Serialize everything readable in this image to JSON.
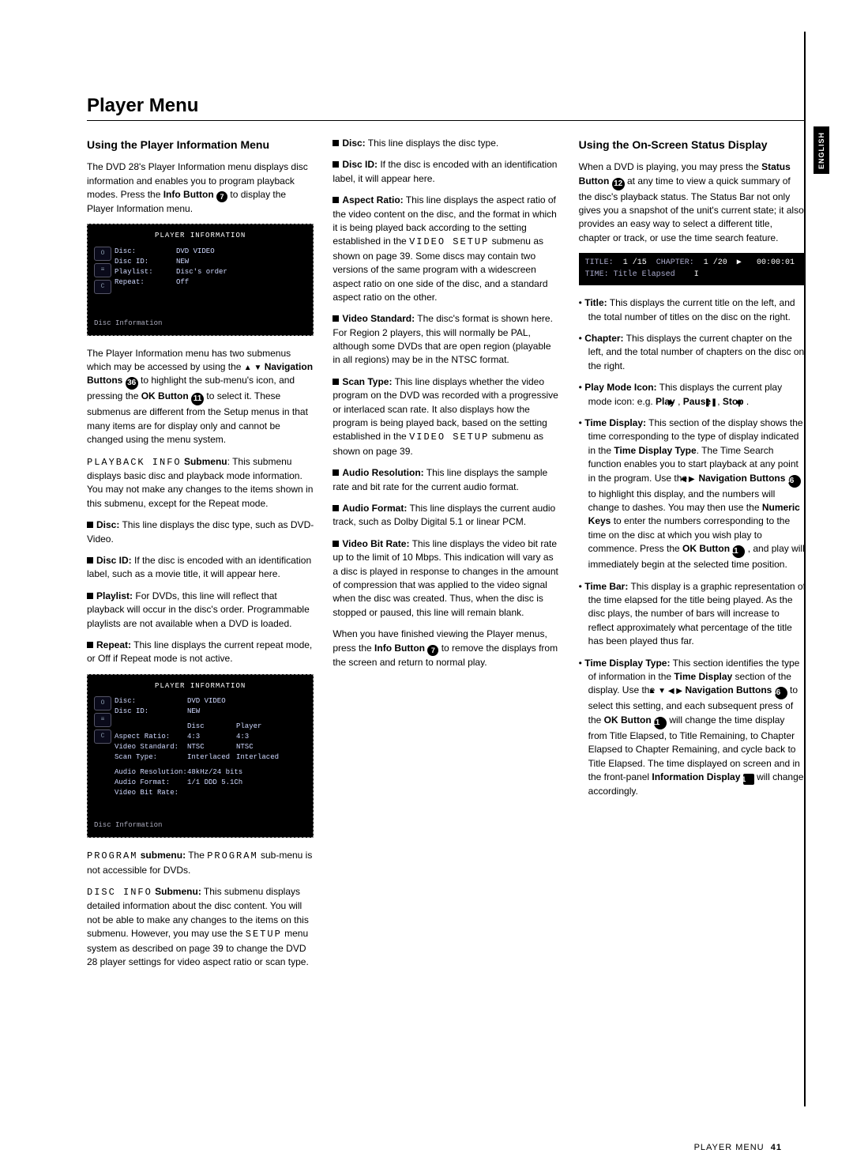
{
  "tab": "ENGLISH",
  "title": "Player Menu",
  "footer": {
    "section": "PLAYER MENU",
    "page": "41"
  },
  "col1": {
    "h": "Using the Player Information Menu",
    "p1a": "The DVD 28's Player Information menu displays disc information and enables you to program playback modes. Press the ",
    "p1b": "Info Button",
    "p1c": " to display the Player Information menu.",
    "osd1": {
      "title": "PLAYER INFORMATION",
      "rows": [
        {
          "k": "Disc:",
          "v": "DVD VIDEO"
        },
        {
          "k": "Disc ID:",
          "v": "NEW"
        },
        {
          "k": "Playlist:",
          "v": "Disc's order"
        },
        {
          "k": "Repeat:",
          "v": "Off"
        }
      ],
      "footer": "Disc Information"
    },
    "p2a": "The Player Information menu has two submenus which may be accessed by using the ",
    "p2b": "Navigation Buttons",
    "p2c": " to highlight the sub-menu's icon, and pressing the ",
    "p2d": "OK Button",
    "p2e": " to select it. These submenus are different from the Setup menus in that many items are for display only and cannot be changed using the menu system.",
    "pbi_label": "PLAYBACK INFO",
    "pbi_sub": " Submenu",
    "pbi_txt": ": This submenu displays basic disc and playback mode information. You may not make any changes to the items shown in this submenu, except for the Repeat mode.",
    "li1k": "Disc:",
    "li1v": " This line displays the disc type, such as DVD-Video.",
    "li2k": "Disc ID:",
    "li2v": " If the disc is encoded with an identification label, such as a movie title, it will appear here.",
    "li3k": "Playlist:",
    "li3v": " For DVDs, this line will reflect that playback will occur in the disc's order. Programmable playlists are not available when a DVD is loaded.",
    "li4k": "Repeat:",
    "li4v": " This line displays the current repeat mode, or Off if Repeat mode is not active.",
    "osd2": {
      "title": "PLAYER INFORMATION",
      "top": [
        {
          "k": "Disc:",
          "v": "DVD VIDEO"
        },
        {
          "k": "Disc ID:",
          "v": "NEW"
        }
      ],
      "hd": {
        "c1": "Disc",
        "c2": "Player"
      },
      "mid": [
        {
          "k": "Aspect Ratio:",
          "c1": "4:3",
          "c2": "4:3"
        },
        {
          "k": "Video Standard:",
          "c1": "NTSC",
          "c2": "NTSC"
        },
        {
          "k": "Scan Type:",
          "c1": "Interlaced",
          "c2": "Interlaced"
        }
      ],
      "bot": [
        {
          "k": "Audio Resolution:",
          "v": "48kHz/24 bits"
        },
        {
          "k": "Audio Format:",
          "v": "1/1 DDD 5.1Ch"
        },
        {
          "k": "Video Bit Rate:",
          "v": ""
        }
      ],
      "footer": "Disc Information"
    },
    "prog_label": "PROGRAM",
    "prog_sub": " submenu:",
    "prog_txt": " The ",
    "prog_label2": "PROGRAM",
    "prog_txt2": " sub-menu is not accessible for DVDs.",
    "di_label": "DISC INFO",
    "di_sub": " Submenu:",
    "di_txt": " This submenu displays detailed information about the disc content. You will not be able to make any changes to the items on this submenu. However, you may use the ",
    "di_setup": "SETUP",
    "di_txt2": " menu system as described on page 39 to change the DVD 28 player settings for video aspect ratio or scan type."
  },
  "col2": {
    "l1k": "Disc:",
    "l1v": " This line displays the disc type.",
    "l2k": "Disc ID:",
    "l2v": " If the disc is encoded with an identification label, it will appear here.",
    "l3k": "Aspect Ratio:",
    "l3v1": " This line displays the aspect ratio of the video content on the disc, and the format in which it is being played back according to the setting established in the ",
    "l3setup": "VIDEO SETUP",
    "l3v2": " submenu as shown on page 39. Some discs may contain two versions of the same program with a widescreen aspect ratio on one side of the disc, and a standard aspect ratio on the other.",
    "l4k": "Video Standard:",
    "l4v": " The disc's format is shown here. For Region 2 players, this will normally be PAL, although some DVDs that are open region (playable in all regions) may be in the NTSC format.",
    "l5k": "Scan Type:",
    "l5v1": " This line displays whether the video program on the DVD was recorded with a progressive or interlaced scan rate. It also displays how the program is being played back, based on the setting established in the ",
    "l5setup": "VIDEO SETUP",
    "l5v2": " submenu as shown on page 39.",
    "l6k": "Audio Resolution:",
    "l6v": " This line displays the sample rate and bit rate for the current audio format.",
    "l7k": "Audio Format:",
    "l7v": " This line displays the current audio track, such as Dolby Digital 5.1 or linear PCM.",
    "l8k": "Video Bit Rate:",
    "l8v": " This line displays the video bit rate up to the limit of 10 Mbps. This indication will vary as a disc is played in response to changes in the amount of compression that was applied to the video signal when the disc was created. Thus, when the disc is stopped or paused, this line will remain blank.",
    "endA": "When you have finished viewing the Player menus, press the ",
    "endB": "Info Button",
    "endC": " to remove the displays from the screen and return to normal play."
  },
  "col3": {
    "h": "Using the On-Screen Status Display",
    "p1a": "When a DVD is playing, you may press the ",
    "p1b": "Status Button",
    "p1c": " at any time to view a quick summary of the disc's playback status. The Status Bar not only gives you a snapshot of the unit's current state; it also provides an easy way to select a different title, chapter or track, or use the time search feature.",
    "status": {
      "title_l": "TITLE:",
      "title_v": "1 /15",
      "ch_l": "CHAPTER:",
      "ch_v": "1 /20",
      "icon": "▶",
      "time": "00:00:01",
      "row2_l": "TIME: Title Elapsed",
      "row2_r": "I"
    },
    "b1k": "Title:",
    "b1v": " This displays the current title on the left, and the total number of titles on the disc on the right.",
    "b2k": "Chapter:",
    "b2v": " This displays the current chapter on the left, and the total number of chapters on the disc on the right.",
    "b3k": "Play Mode Icon:",
    "b3v1": " This displays the current play mode icon: e.g. ",
    "b3play": "Play",
    "b3pause": "Pause",
    "b3stop": "Stop",
    "b4k": "Time Display:",
    "b4v1": " This section of the display shows the time corresponding to the type of display indicated in the ",
    "b4tdt": "Time Display Type",
    "b4v2": ". The Time Search function enables you to start playback at any point in the program. Use the ",
    "b4nav": "Navigation Buttons",
    "b4v3": " to highlight this display, and the numbers will change to dashes. You may then use the ",
    "b4nk": "Numeric Keys",
    "b4v4": " to enter the numbers corresponding to the time on the disc at which you wish play to commence. Press the ",
    "b4ok": "OK Button",
    "b4v5": ", and play will immediately begin at the selected time position.",
    "b5k": "Time Bar:",
    "b5v": " This display is a graphic representation of the time elapsed for the title being played. As the disc plays, the number of bars will increase to reflect approximately what percentage of the title has been played thus far.",
    "b6k": "Time Display Type:",
    "b6v1": " This section identifies the type of information in the ",
    "b6td": "Time Display",
    "b6v2": " section of the display. Use the ",
    "b6nav": "Navigation Buttons",
    "b6v3": " to select this setting, and each subsequent press of the ",
    "b6ok": "OK Button",
    "b6v4": " will change the time display from Title Elapsed, to Title Remaining, to Chapter Elapsed to Chapter Remaining, and cycle back to Title Elapsed. The time displayed on screen and in the front-panel ",
    "b6id": "Information Display",
    "b6v5": " will change accordingly."
  }
}
